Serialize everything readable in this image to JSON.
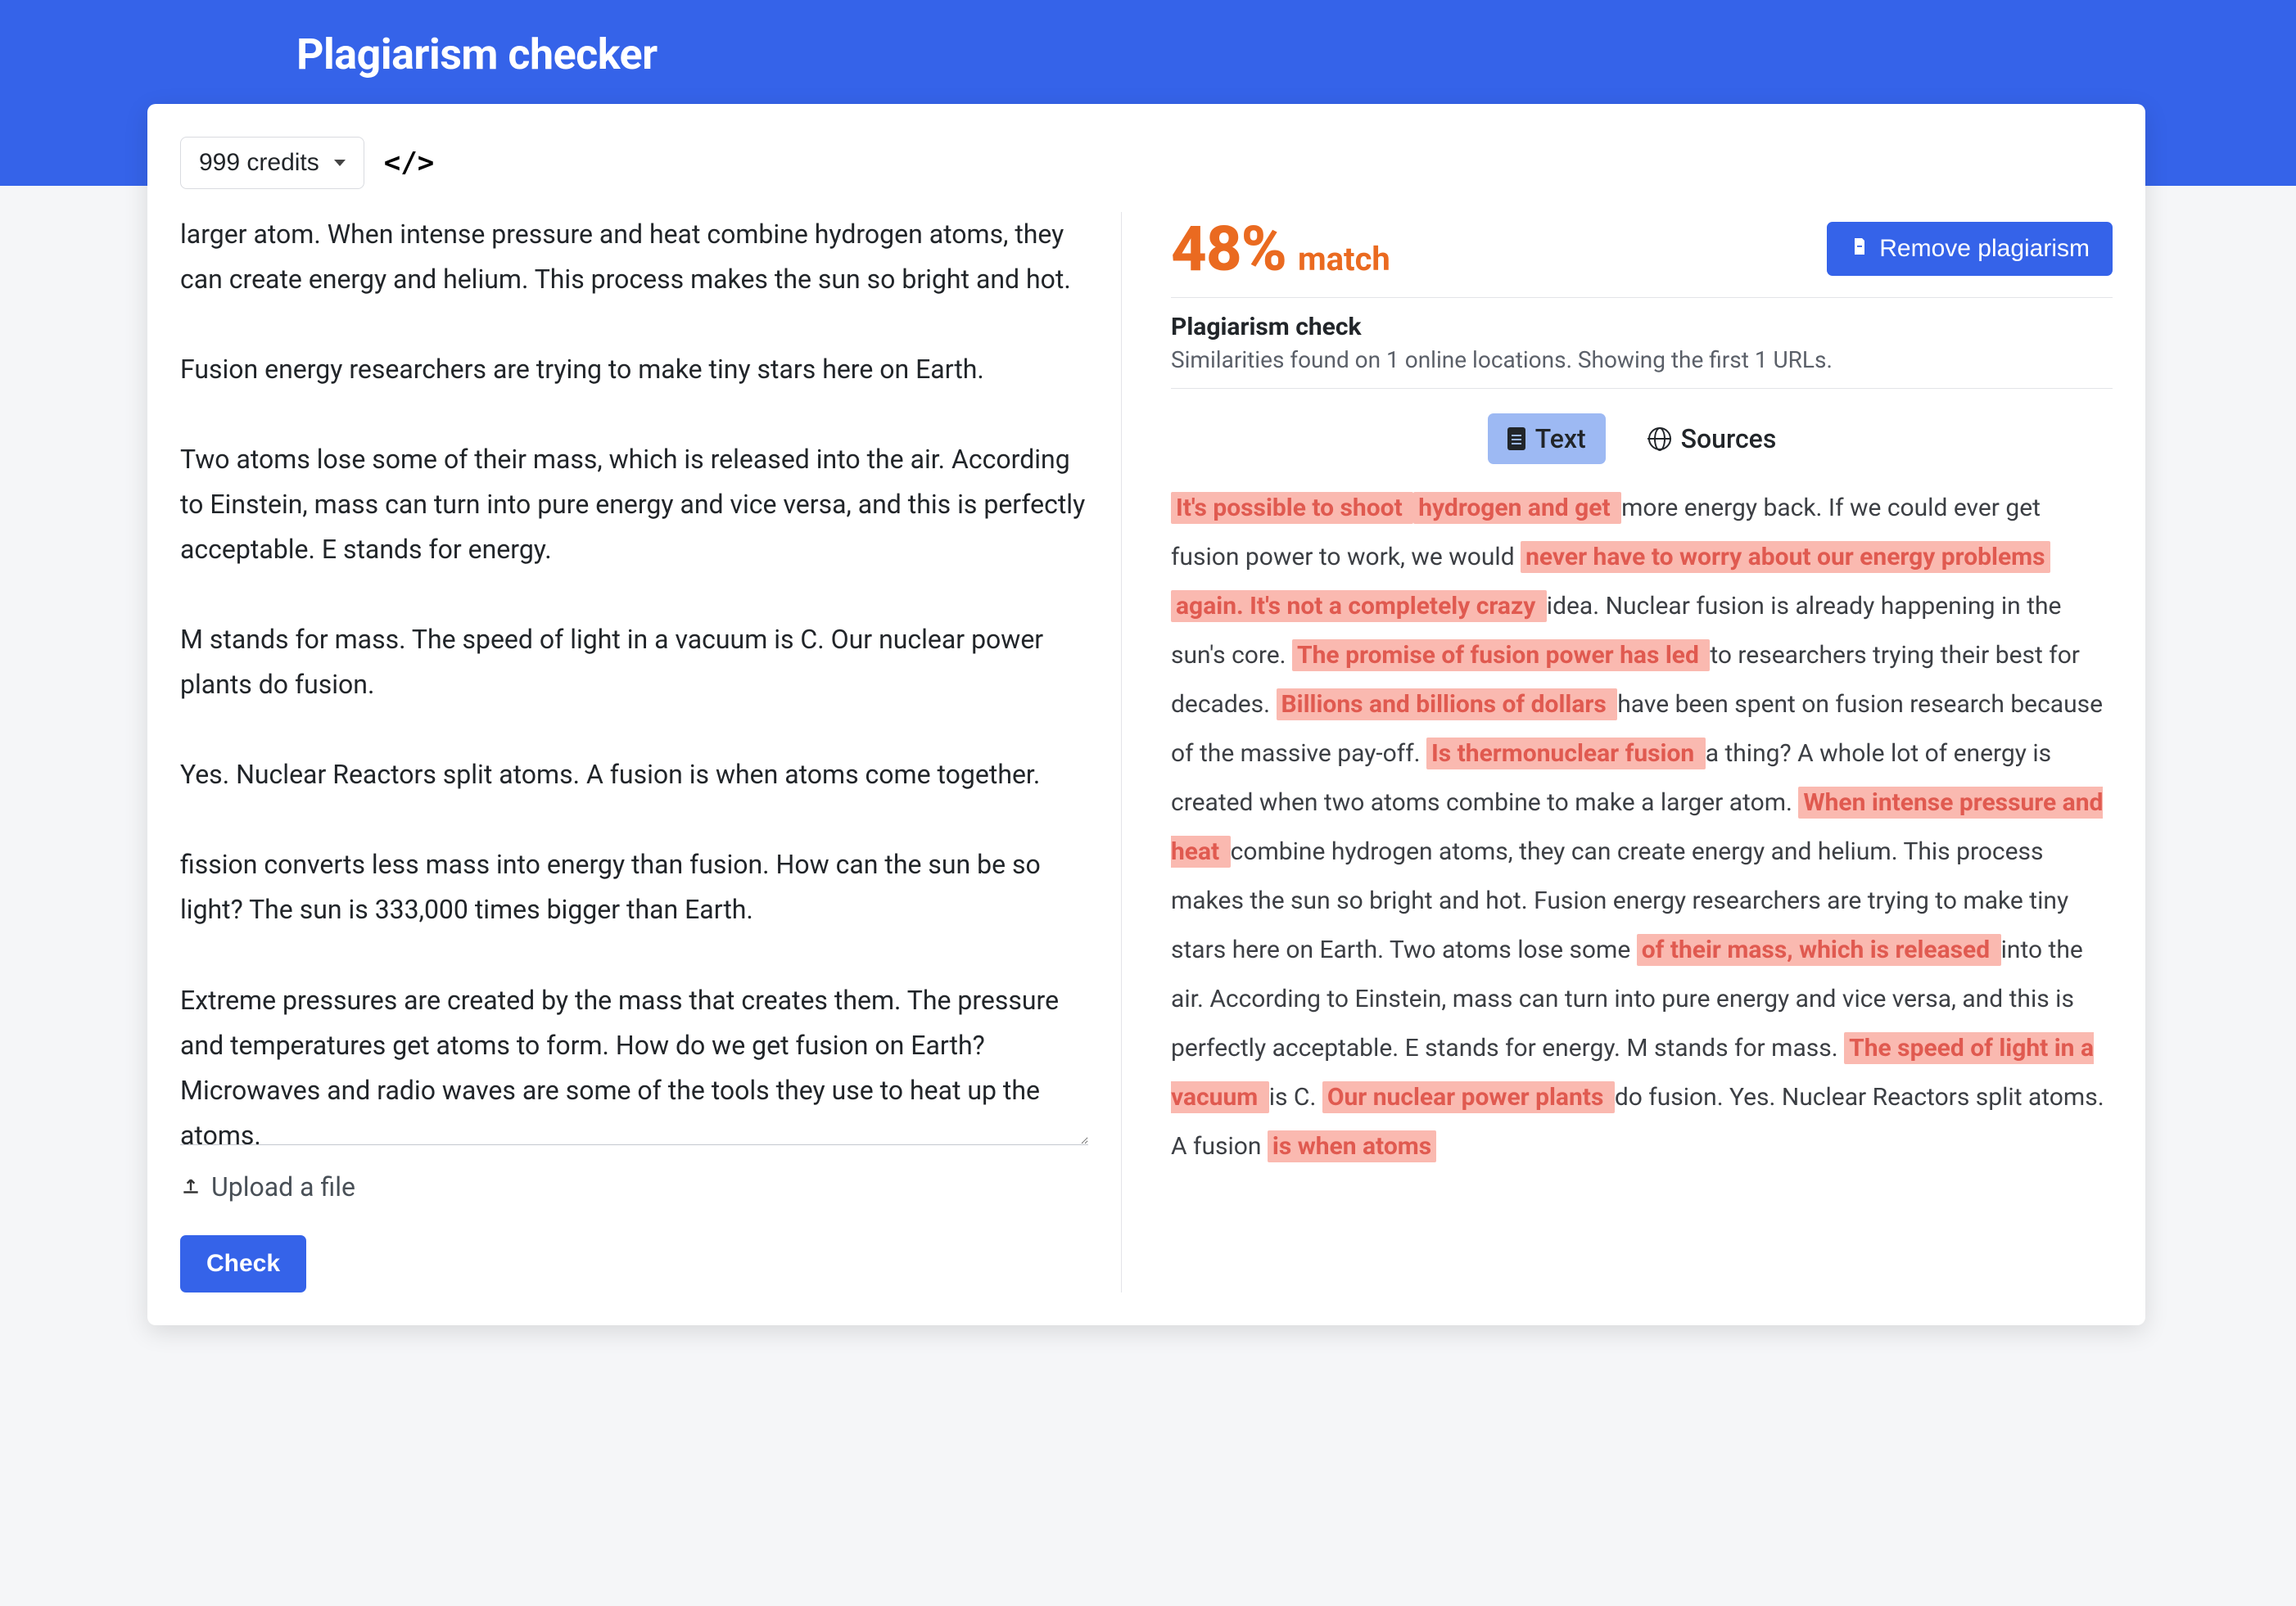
{
  "page": {
    "title": "Plagiarism checker"
  },
  "toolbar": {
    "credits_label": "999 credits"
  },
  "left": {
    "input_text": "larger atom. When intense pressure and heat combine hydrogen atoms, they can create energy and helium. This process makes the sun so bright and hot.\n\nFusion energy researchers are trying to make tiny stars here on Earth.\n\nTwo atoms lose some of their mass, which is released into the air. According to Einstein, mass can turn into pure energy and vice versa, and this is perfectly acceptable. E stands for energy.\n\nM stands for mass. The speed of light in a vacuum is C. Our nuclear power plants do fusion.\n\nYes. Nuclear Reactors split atoms. A fusion is when atoms come together.\n\nfission converts less mass into energy than fusion. How can the sun be so light? The sun is 333,000 times bigger than Earth.\n\nExtreme pressures are created by the mass that creates them. The pressure and temperatures get atoms to form. How do we get fusion on Earth? Microwaves and radio waves are some of the tools they use to heat up the atoms.",
    "upload_label": "Upload a file",
    "check_label": "Check"
  },
  "result": {
    "percent": "48%",
    "match_label": "match",
    "remove_label": "Remove plagiarism",
    "subtitle": "Plagiarism check",
    "subdescription": "Similarities found on 1 online locations. Showing the first 1 URLs.",
    "tabs": {
      "text": "Text",
      "sources": "Sources"
    },
    "segments": [
      {
        "t": " It's possible to shoot ",
        "h": true
      },
      {
        "t": " ",
        "h": false
      },
      {
        "t": " hydrogen and get ",
        "h": true
      },
      {
        "t": " more energy back. If we could ever get fusion power to work, we would ",
        "h": false
      },
      {
        "t": " never have to worry about our energy problems ",
        "h": true
      },
      {
        "t": " ",
        "h": false
      },
      {
        "t": " again. It's not a completely crazy ",
        "h": true
      },
      {
        "t": " idea. Nuclear fusion is already happening in the sun's core. ",
        "h": false
      },
      {
        "t": " The promise of fusion power has led ",
        "h": true
      },
      {
        "t": " to researchers trying their best for decades. ",
        "h": false
      },
      {
        "t": " Billions and billions of dollars ",
        "h": true
      },
      {
        "t": " have been spent on fusion research because of the massive pay-off. ",
        "h": false
      },
      {
        "t": " Is thermonuclear fusion ",
        "h": true
      },
      {
        "t": " a thing? A whole lot of energy is created when two atoms combine to make a larger atom. ",
        "h": false
      },
      {
        "t": " When intense pressure and heat ",
        "h": true
      },
      {
        "t": " combine hydrogen atoms, they can create energy and helium. This process makes the sun so bright and hot. Fusion energy researchers are trying to make tiny stars here on Earth. Two atoms lose some ",
        "h": false
      },
      {
        "t": " of their mass, which is released ",
        "h": true
      },
      {
        "t": " into the air. According to Einstein, mass can turn into pure energy and vice versa, and this is perfectly acceptable. E stands for energy. M stands for mass. ",
        "h": false
      },
      {
        "t": " The speed of light in a vacuum ",
        "h": true
      },
      {
        "t": " is C. ",
        "h": false
      },
      {
        "t": " Our nuclear power plants ",
        "h": true
      },
      {
        "t": " do fusion. Yes. Nuclear Reactors split atoms. A fusion ",
        "h": false
      },
      {
        "t": " is when atoms ",
        "h": true
      }
    ]
  }
}
